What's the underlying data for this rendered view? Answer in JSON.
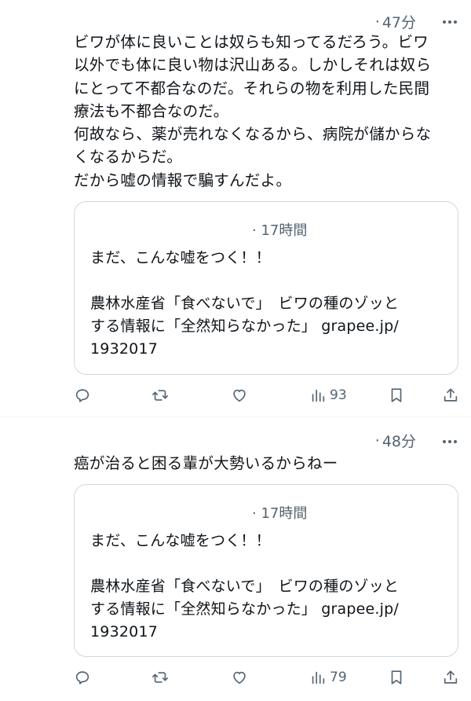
{
  "posts": [
    {
      "time": "47分",
      "text": "ビワが体に良いことは奴らも知ってるだろう。ビワ\n以外でも体に良い物は沢山ある。しかしそれは奴ら\nにとって不都合なのだ。それらの物を利用した民間\n療法も不都合なのだ。\n何故なら、薬が売れなくなるから、病院が儲からな\nくなるからだ。\nだから嘘の情報で騙すんだよ。",
      "quote": {
        "time": "17時間",
        "text": "まだ、こんな嘘をつく！！\n\n農林水産省「食べないで」　ビワの種のゾッと\nする情報に「全然知らなかった」 grapee.jp/\n1932017"
      },
      "views": "93"
    },
    {
      "time": "48分",
      "text": "癌が治ると困る輩が大勢いるからねー",
      "quote": {
        "time": "17時間",
        "text": "まだ、こんな嘘をつく！！\n\n農林水産省「食べないで」　ビワの種のゾッと\nする情報に「全然知らなかった」 grapee.jp/\n1932017"
      },
      "views": "79"
    }
  ],
  "icons": [
    "reply-icon",
    "retweet-icon",
    "like-icon",
    "views-icon",
    "bookmark-icon",
    "share-icon",
    "more-icon"
  ],
  "colors": {
    "text": "#0f1419",
    "secondary": "#536471",
    "border": "#cfd9de"
  }
}
